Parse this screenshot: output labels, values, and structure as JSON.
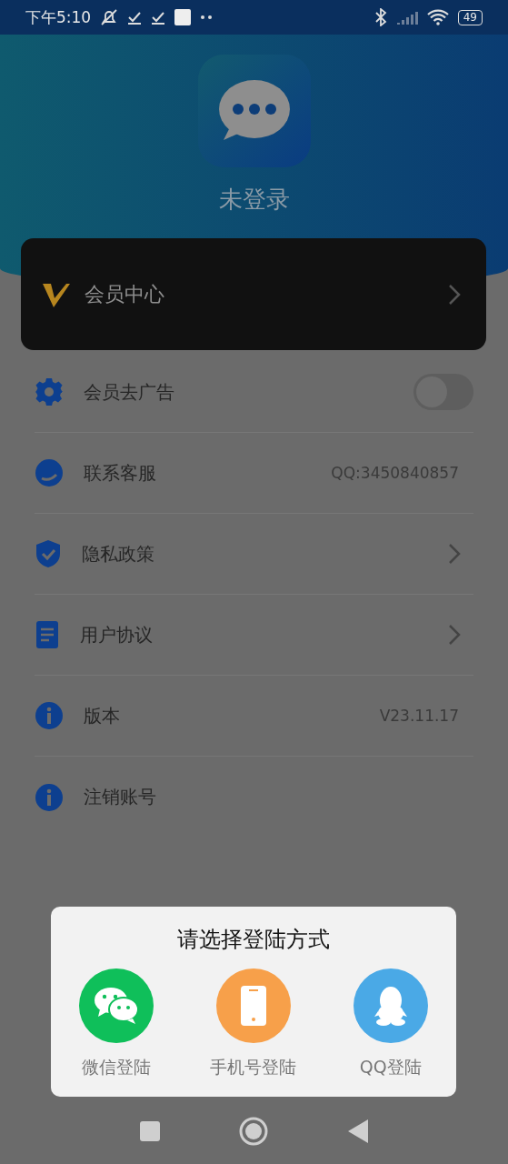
{
  "status_bar": {
    "time": "下午5:10",
    "battery": "49"
  },
  "header": {
    "title": "未登录"
  },
  "vip_card": {
    "label": "会员中心"
  },
  "menu": [
    {
      "kind": "toggle",
      "label": "会员去广告",
      "on": false
    },
    {
      "kind": "value",
      "label": "联系客服",
      "value": "QQ:3450840857"
    },
    {
      "kind": "link",
      "label": "隐私政策"
    },
    {
      "kind": "link",
      "label": "用户协议"
    },
    {
      "kind": "value",
      "label": "版本",
      "value": "V23.11.17"
    },
    {
      "kind": "plain",
      "label": "注销账号"
    }
  ],
  "login_dialog": {
    "title": "请选择登陆方式",
    "options": [
      {
        "label": "微信登陆",
        "color": "#0fbf5a"
      },
      {
        "label": "手机号登陆",
        "color": "#f7a04a"
      },
      {
        "label": "QQ登陆",
        "color": "#4aa9e6"
      }
    ]
  }
}
